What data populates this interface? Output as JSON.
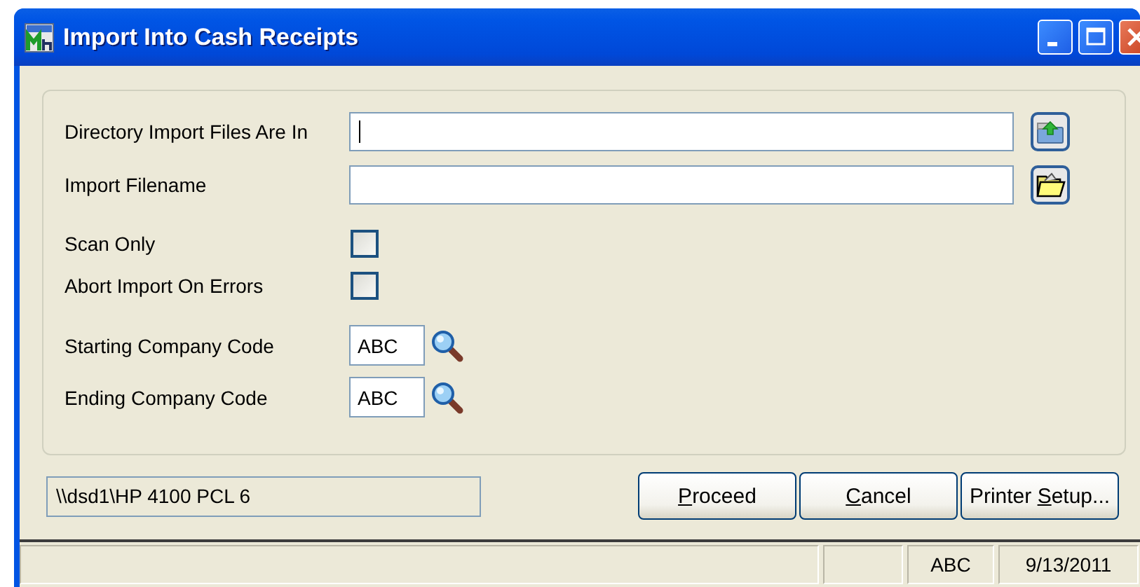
{
  "window": {
    "title": "Import Into Cash Receipts"
  },
  "title_buttons": [
    {
      "kind": "minimize"
    },
    {
      "kind": "maximize"
    },
    {
      "kind": "close"
    }
  ],
  "fields": [
    {
      "kind": "directory",
      "label": "Directory Import Files Are In",
      "focused": true
    },
    {
      "kind": "file",
      "label": "Import Filename",
      "focused": false
    },
    {
      "kind": "checkbox",
      "label": "Scan Only",
      "checked": false
    },
    {
      "kind": "checkbox",
      "label": "Abort Import On Errors",
      "checked": false
    },
    {
      "kind": "lookup",
      "label": "Starting Company Code",
      "value": "ABC"
    },
    {
      "kind": "lookup",
      "label": "Ending Company Code",
      "value": "ABC"
    }
  ],
  "printer": {
    "value": "\\\\dsd1\\HP 4100 PCL 6"
  },
  "buttons": [
    {
      "label": "Proceed",
      "access_key_underlined": true
    },
    {
      "label": "Cancel",
      "access_key_underlined": true
    },
    {
      "label": "Printer Setup...",
      "access_key_underlined": true
    }
  ],
  "status_bar": {
    "company": "ABC",
    "date": "9/13/2011"
  }
}
